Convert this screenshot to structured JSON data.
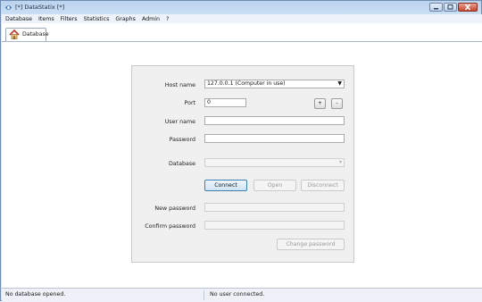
{
  "window": {
    "title": "[*] DataStatix [*]",
    "app_icon": "datastatix-logo-icon"
  },
  "menu": {
    "items": [
      "Database",
      "Items",
      "Filters",
      "Statistics",
      "Graphs",
      "Admin",
      "?"
    ]
  },
  "tabs": [
    {
      "label": "Database",
      "icon": "house-icon"
    }
  ],
  "form": {
    "host_label": "Host name",
    "host_value": "127.0.0.1 (Computer in use)",
    "port_label": "Port",
    "port_value": "0",
    "plus_label": "+",
    "minus_label": "-",
    "user_label": "User name",
    "user_value": "",
    "password_label": "Password",
    "password_value": "",
    "database_label": "Database",
    "database_value": "",
    "connect_label": "Connect",
    "open_label": "Open",
    "disconnect_label": "Disconnect",
    "new_password_label": "New password",
    "confirm_password_label": "Confirm password",
    "change_password_label": "Change password"
  },
  "status": {
    "left": "No database opened.",
    "middle": "No user connected."
  },
  "colors": {
    "titlebar": "#c6dcf2",
    "close_button": "#c8442f",
    "panel": "#f0f0f0",
    "primary_button_border": "#3c7fb1"
  }
}
